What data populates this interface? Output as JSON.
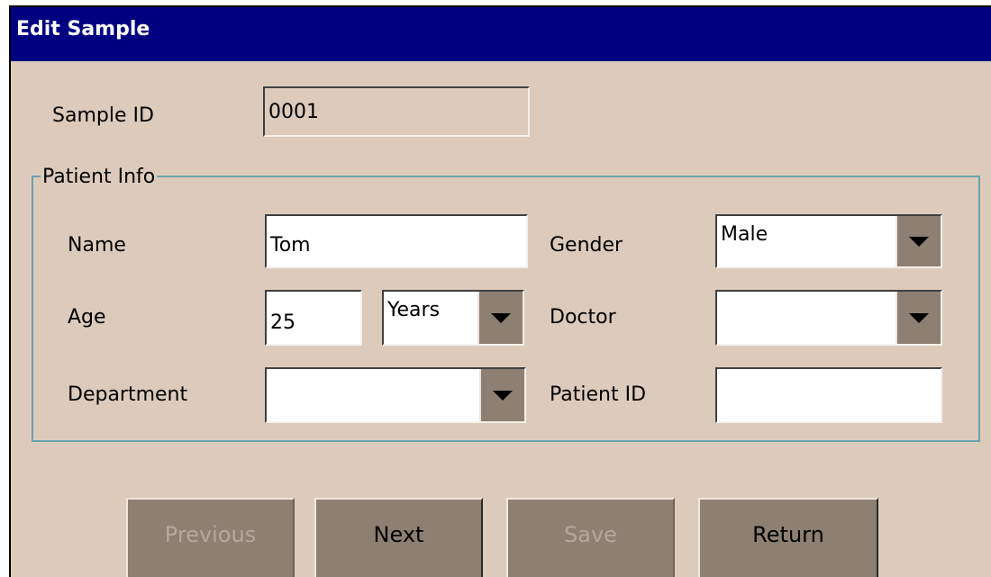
{
  "window": {
    "title": "Edit Sample"
  },
  "sample": {
    "label": "Sample ID",
    "value": "0001"
  },
  "patient_info": {
    "caption": "Patient Info",
    "name": {
      "label": "Name",
      "value": "Tom"
    },
    "gender": {
      "label": "Gender",
      "value": "Male"
    },
    "age": {
      "label": "Age",
      "value": "25",
      "unit": "Years"
    },
    "doctor": {
      "label": "Doctor",
      "value": ""
    },
    "department": {
      "label": "Department",
      "value": ""
    },
    "patient_id": {
      "label": "Patient ID",
      "value": ""
    }
  },
  "buttons": {
    "previous": "Previous",
    "next": "Next",
    "save": "Save",
    "return": "Return"
  },
  "icons": {
    "dropdown": "chevron-down-icon"
  },
  "colors": {
    "title_bar": "#000080",
    "background": "#dccbbb",
    "button": "#8e7f73",
    "group_border": "#6aa3b0"
  }
}
